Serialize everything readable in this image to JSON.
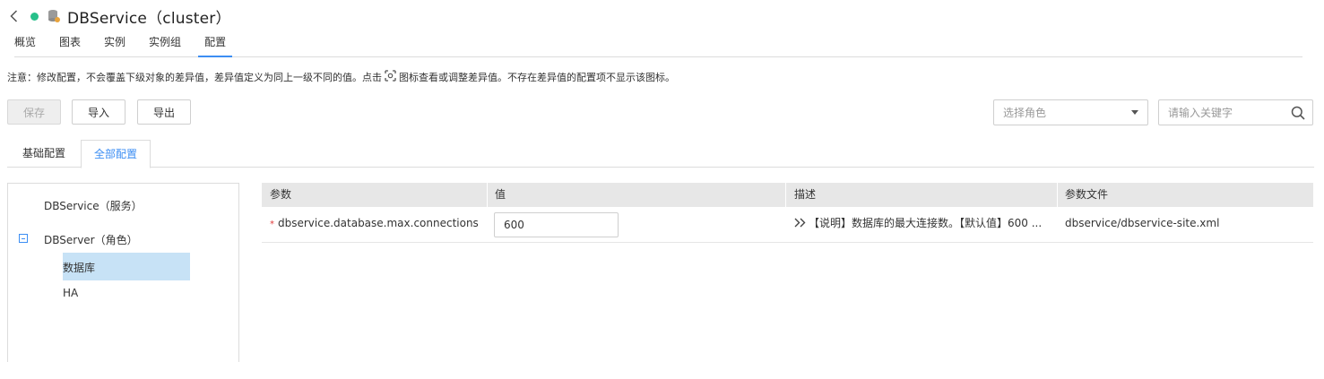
{
  "header": {
    "title": "DBService（cluster）",
    "status_color": "#27c08a",
    "back_icon": "chevron-left-icon",
    "service_icon": "database-icon"
  },
  "nav_tabs": [
    {
      "label": "概览",
      "active": false
    },
    {
      "label": "图表",
      "active": false
    },
    {
      "label": "实例",
      "active": false
    },
    {
      "label": "实例组",
      "active": false
    },
    {
      "label": "配置",
      "active": true
    }
  ],
  "notice": {
    "before": "注意：修改配置，不会覆盖下级对象的差异值，差异值定义为同上一级不同的值。点击",
    "after": "图标查看或调整差异值。不存在差异值的配置项不显示该图标。",
    "icon": "diff-icon"
  },
  "toolbar": {
    "save_label": "保存",
    "import_label": "导入",
    "export_label": "导出"
  },
  "role_select": {
    "placeholder": "选择角色"
  },
  "search": {
    "placeholder": "请输入关键字"
  },
  "sub_tabs": [
    {
      "label": "基础配置",
      "active": false
    },
    {
      "label": "全部配置",
      "active": true
    }
  ],
  "tree": {
    "service": "DBService（服务）",
    "role": "DBServer（角色）",
    "children": [
      "数据库",
      "HA"
    ],
    "selected": "数据库"
  },
  "table": {
    "columns": [
      "参数",
      "值",
      "描述",
      "参数文件"
    ],
    "rows": [
      {
        "param": "dbservice.database.max.connections",
        "required": "*",
        "value": "600",
        "description": "【说明】数据库的最大连接数。【默认值】600 ...",
        "file": "dbservice/dbservice-site.xml"
      }
    ]
  },
  "colors": {
    "accent": "#3c8ef3",
    "selected_row": "#c7e2f6",
    "required": "#e23b3b"
  }
}
